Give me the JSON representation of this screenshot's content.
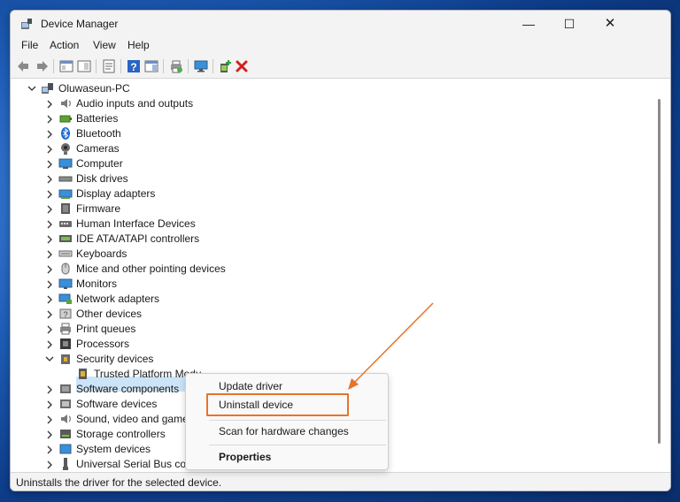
{
  "window": {
    "title": "Device Manager",
    "controls": {
      "minimize": "—",
      "maximize": "☐",
      "close": "✕"
    }
  },
  "menu": {
    "file": "File",
    "action": "Action",
    "view": "View",
    "help": "Help"
  },
  "toolbar": {
    "icons": [
      "back-arrow-icon",
      "forward-arrow-icon",
      "console-tree-icon",
      "properties-icon",
      "help-icon",
      "action-pane-icon",
      "print-icon",
      "monitor-icon",
      "add-driver-icon",
      "remove-x-icon"
    ]
  },
  "tree": {
    "root": "Oluwaseun-PC",
    "categories": [
      {
        "label": "Audio inputs and outputs",
        "icon": "speaker-icon"
      },
      {
        "label": "Batteries",
        "icon": "battery-icon"
      },
      {
        "label": "Bluetooth",
        "icon": "bluetooth-icon"
      },
      {
        "label": "Cameras",
        "icon": "camera-icon"
      },
      {
        "label": "Computer",
        "icon": "computer-icon"
      },
      {
        "label": "Disk drives",
        "icon": "disk-icon"
      },
      {
        "label": "Display adapters",
        "icon": "display-adapter-icon"
      },
      {
        "label": "Firmware",
        "icon": "firmware-icon"
      },
      {
        "label": "Human Interface Devices",
        "icon": "hid-icon"
      },
      {
        "label": "IDE ATA/ATAPI controllers",
        "icon": "ide-icon"
      },
      {
        "label": "Keyboards",
        "icon": "keyboard-icon"
      },
      {
        "label": "Mice and other pointing devices",
        "icon": "mouse-icon"
      },
      {
        "label": "Monitors",
        "icon": "monitor-icon"
      },
      {
        "label": "Network adapters",
        "icon": "network-icon"
      },
      {
        "label": "Other devices",
        "icon": "other-devices-icon"
      },
      {
        "label": "Print queues",
        "icon": "printer-icon"
      },
      {
        "label": "Processors",
        "icon": "processor-icon"
      },
      {
        "label": "Security devices",
        "icon": "security-icon",
        "expanded": true
      },
      {
        "label": "Software components",
        "icon": "software-component-icon"
      },
      {
        "label": "Software devices",
        "icon": "software-device-icon"
      },
      {
        "label": "Sound, video and game co",
        "icon": "sound-icon"
      },
      {
        "label": "Storage controllers",
        "icon": "storage-icon"
      },
      {
        "label": "System devices",
        "icon": "system-icon"
      },
      {
        "label": "Universal Serial Bus contro",
        "icon": "usb-icon"
      }
    ],
    "selected_child": "Trusted Platform Modu"
  },
  "context_menu": {
    "update": "Update driver",
    "uninstall": "Uninstall device",
    "scan": "Scan for hardware changes",
    "properties": "Properties"
  },
  "status": {
    "text": "Uninstalls the driver for the selected device."
  },
  "colors": {
    "highlight": "#e8732b",
    "selection": "#cce4f7"
  }
}
